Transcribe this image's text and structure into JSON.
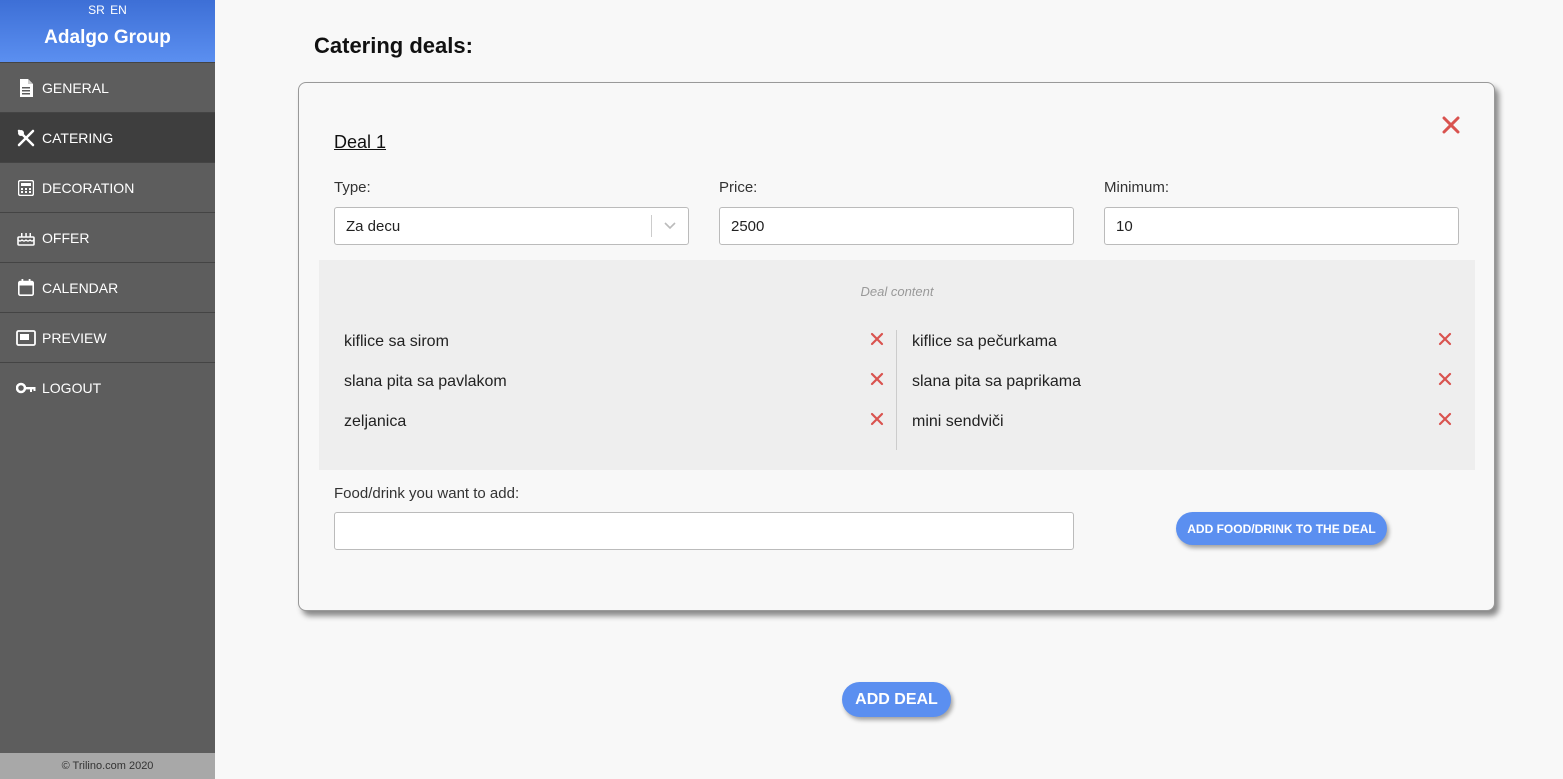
{
  "brand": {
    "lang_sr": "SR",
    "lang_en": "EN",
    "title": "Adalgo Group"
  },
  "sidebar": {
    "items": [
      {
        "label": "GENERAL",
        "icon": "document-icon"
      },
      {
        "label": "CATERING",
        "icon": "utensils-icon",
        "active": true
      },
      {
        "label": "DECORATION",
        "icon": "calculator-icon"
      },
      {
        "label": "OFFER",
        "icon": "cake-icon"
      },
      {
        "label": "CALENDAR",
        "icon": "calendar-icon"
      },
      {
        "label": "PREVIEW",
        "icon": "window-icon"
      },
      {
        "label": "LOGOUT",
        "icon": "key-icon"
      }
    ],
    "footer": "© Trilino.com 2020"
  },
  "main": {
    "title": "Catering deals:",
    "deal": {
      "title": "Deal 1",
      "type_label": "Type:",
      "type_value": "Za decu",
      "price_label": "Price:",
      "price_value": "2500",
      "minimum_label": "Minimum:",
      "minimum_value": "10",
      "content_heading": "Deal content",
      "items_left": [
        "kiflice sa sirom",
        "slana pita sa pavlakom",
        "zeljanica"
      ],
      "items_right": [
        "kiflice sa pečurkama",
        "slana pita sa paprikama",
        "mini sendviči"
      ],
      "add_label": "Food/drink you want to add:",
      "add_placeholder": "",
      "add_button": "ADD FOOD/DRINK TO THE DEAL"
    },
    "add_deal_button": "ADD DEAL"
  },
  "colors": {
    "accent": "#5b8ff0",
    "remove": "#d9534f",
    "sidebar": "#5d5d5d"
  }
}
